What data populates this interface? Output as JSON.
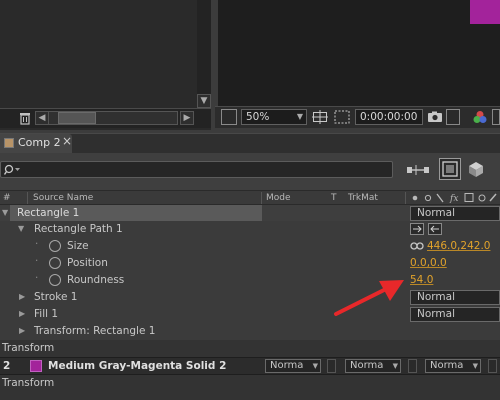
{
  "viewer": {
    "zoom": "50%",
    "timecode": "0:00:00:00"
  },
  "tab": {
    "label": "Comp 2",
    "close": "×"
  },
  "columns": {
    "hash": "#",
    "source_name": "Source Name",
    "mode": "Mode",
    "t": "T",
    "trkmat": "TrkMat"
  },
  "layers": {
    "rect1": {
      "name": "Rectangle 1",
      "mode": "Normal"
    },
    "rect_path": {
      "name": "Rectangle Path 1"
    },
    "size": {
      "label": "Size",
      "value": "446.0,242.0"
    },
    "position": {
      "label": "Position",
      "value": "0.0,0.0"
    },
    "roundness": {
      "label": "Roundness",
      "value": "54.0"
    },
    "stroke": {
      "name": "Stroke 1",
      "mode": "Normal"
    },
    "fill": {
      "name": "Fill 1",
      "mode": "Normal"
    },
    "transform_rect": {
      "name": "Transform: Rectangle 1"
    },
    "transform1": {
      "name": "Transform"
    },
    "solid": {
      "index": "2",
      "name": "Medium Gray-Magenta Solid 2",
      "color": "#a3239b",
      "mode": "Norma",
      "trkmat": "Norma",
      "parent": "Norma"
    },
    "transform2": {
      "name": "Transform"
    }
  },
  "icons": [
    "trash-icon",
    "stopwatch-icon",
    "link-icon",
    "camera-icon",
    "color-channels-icon",
    "search-icon",
    "draft-3d-icon",
    "motion-blur-icon"
  ],
  "colors": {
    "accent_value": "#e2a32b",
    "solid_label": "#a3239b",
    "annotation_arrow": "#e8282a"
  }
}
